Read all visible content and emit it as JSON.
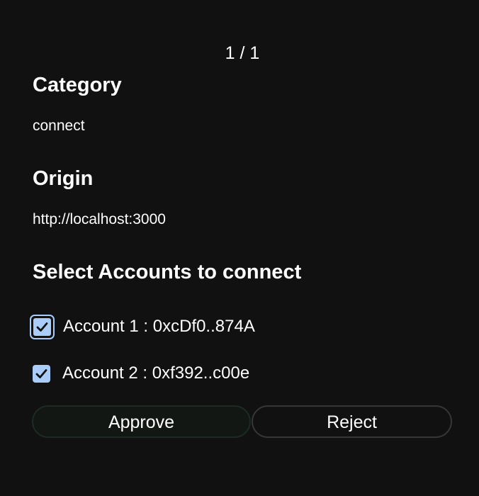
{
  "pager": {
    "text": "1 / 1"
  },
  "request": {
    "category_heading": "Category",
    "category_value": "connect",
    "origin_heading": "Origin",
    "origin_value": "http://localhost:3000",
    "accounts_heading": "Select Accounts to connect"
  },
  "accounts": [
    {
      "label": "Account 1 : 0xcDf0..874A",
      "checked": true
    },
    {
      "label": "Account 2 : 0xf392..c00e",
      "checked": true
    }
  ],
  "actions": {
    "approve_label": "Approve",
    "reject_label": "Reject"
  },
  "colors": {
    "background": "#111111",
    "checkbox_accent": "#a9cdf8",
    "text": "#ffffff"
  },
  "icons": {
    "checkbox_check": "check-icon"
  }
}
